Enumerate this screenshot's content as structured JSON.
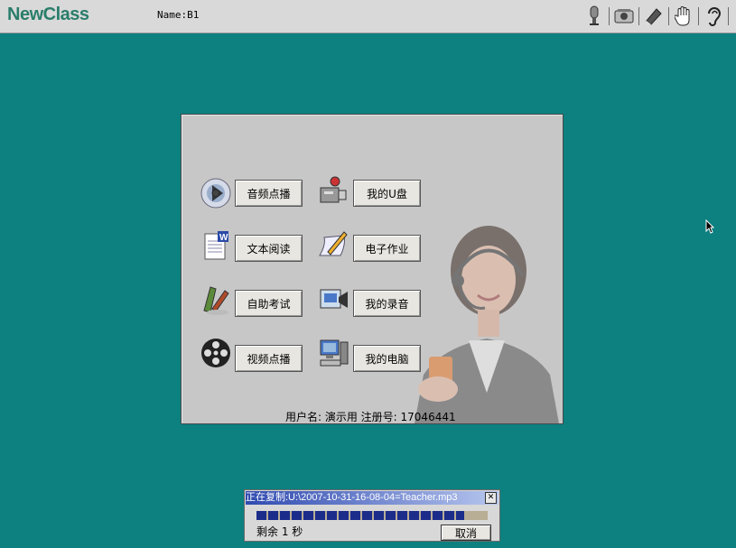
{
  "app": {
    "logo": "NewClass",
    "name_label": "Name:B1"
  },
  "toolbar": {
    "icons": [
      "microphone-icon",
      "speaker-icon",
      "pencil-icon",
      "hand-icon",
      "ear-icon"
    ]
  },
  "menu": {
    "left": [
      "音频点播",
      "文本阅读",
      "自助考试",
      "视频点播"
    ],
    "right": [
      "我的U盘",
      "电子作业",
      "我的录音",
      "我的电脑"
    ]
  },
  "footer": "用户名: 演示用  注册号: 17046441",
  "copy_dialog": {
    "title": "正在复制:U:\\2007-10-31-16-08-04=Teacher.mp3",
    "close": "✕",
    "progress": 0.9,
    "remaining": "剩余 1 秒",
    "cancel": "取消"
  },
  "colors": {
    "desktop": "#0d8080",
    "panel": "#c8c7c8",
    "progress": "#1c2c8a"
  }
}
